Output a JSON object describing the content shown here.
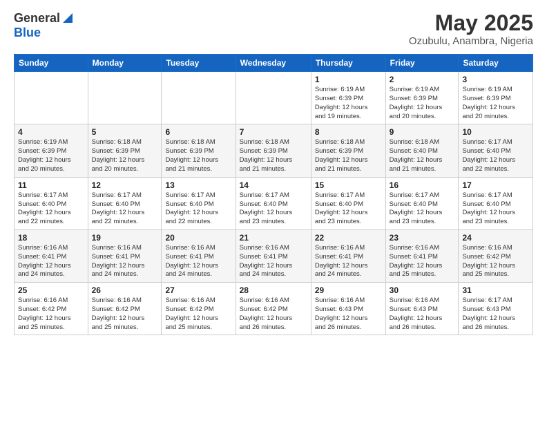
{
  "header": {
    "logo_general": "General",
    "logo_blue": "Blue",
    "title": "May 2025",
    "subtitle": "Ozubulu, Anambra, Nigeria"
  },
  "calendar": {
    "days_of_week": [
      "Sunday",
      "Monday",
      "Tuesday",
      "Wednesday",
      "Thursday",
      "Friday",
      "Saturday"
    ],
    "weeks": [
      [
        {
          "day": "",
          "info": ""
        },
        {
          "day": "",
          "info": ""
        },
        {
          "day": "",
          "info": ""
        },
        {
          "day": "",
          "info": ""
        },
        {
          "day": "1",
          "info": "Sunrise: 6:19 AM\nSunset: 6:39 PM\nDaylight: 12 hours\nand 19 minutes."
        },
        {
          "day": "2",
          "info": "Sunrise: 6:19 AM\nSunset: 6:39 PM\nDaylight: 12 hours\nand 20 minutes."
        },
        {
          "day": "3",
          "info": "Sunrise: 6:19 AM\nSunset: 6:39 PM\nDaylight: 12 hours\nand 20 minutes."
        }
      ],
      [
        {
          "day": "4",
          "info": "Sunrise: 6:19 AM\nSunset: 6:39 PM\nDaylight: 12 hours\nand 20 minutes."
        },
        {
          "day": "5",
          "info": "Sunrise: 6:18 AM\nSunset: 6:39 PM\nDaylight: 12 hours\nand 20 minutes."
        },
        {
          "day": "6",
          "info": "Sunrise: 6:18 AM\nSunset: 6:39 PM\nDaylight: 12 hours\nand 21 minutes."
        },
        {
          "day": "7",
          "info": "Sunrise: 6:18 AM\nSunset: 6:39 PM\nDaylight: 12 hours\nand 21 minutes."
        },
        {
          "day": "8",
          "info": "Sunrise: 6:18 AM\nSunset: 6:39 PM\nDaylight: 12 hours\nand 21 minutes."
        },
        {
          "day": "9",
          "info": "Sunrise: 6:18 AM\nSunset: 6:40 PM\nDaylight: 12 hours\nand 21 minutes."
        },
        {
          "day": "10",
          "info": "Sunrise: 6:17 AM\nSunset: 6:40 PM\nDaylight: 12 hours\nand 22 minutes."
        }
      ],
      [
        {
          "day": "11",
          "info": "Sunrise: 6:17 AM\nSunset: 6:40 PM\nDaylight: 12 hours\nand 22 minutes."
        },
        {
          "day": "12",
          "info": "Sunrise: 6:17 AM\nSunset: 6:40 PM\nDaylight: 12 hours\nand 22 minutes."
        },
        {
          "day": "13",
          "info": "Sunrise: 6:17 AM\nSunset: 6:40 PM\nDaylight: 12 hours\nand 22 minutes."
        },
        {
          "day": "14",
          "info": "Sunrise: 6:17 AM\nSunset: 6:40 PM\nDaylight: 12 hours\nand 23 minutes."
        },
        {
          "day": "15",
          "info": "Sunrise: 6:17 AM\nSunset: 6:40 PM\nDaylight: 12 hours\nand 23 minutes."
        },
        {
          "day": "16",
          "info": "Sunrise: 6:17 AM\nSunset: 6:40 PM\nDaylight: 12 hours\nand 23 minutes."
        },
        {
          "day": "17",
          "info": "Sunrise: 6:17 AM\nSunset: 6:40 PM\nDaylight: 12 hours\nand 23 minutes."
        }
      ],
      [
        {
          "day": "18",
          "info": "Sunrise: 6:16 AM\nSunset: 6:41 PM\nDaylight: 12 hours\nand 24 minutes."
        },
        {
          "day": "19",
          "info": "Sunrise: 6:16 AM\nSunset: 6:41 PM\nDaylight: 12 hours\nand 24 minutes."
        },
        {
          "day": "20",
          "info": "Sunrise: 6:16 AM\nSunset: 6:41 PM\nDaylight: 12 hours\nand 24 minutes."
        },
        {
          "day": "21",
          "info": "Sunrise: 6:16 AM\nSunset: 6:41 PM\nDaylight: 12 hours\nand 24 minutes."
        },
        {
          "day": "22",
          "info": "Sunrise: 6:16 AM\nSunset: 6:41 PM\nDaylight: 12 hours\nand 24 minutes."
        },
        {
          "day": "23",
          "info": "Sunrise: 6:16 AM\nSunset: 6:41 PM\nDaylight: 12 hours\nand 25 minutes."
        },
        {
          "day": "24",
          "info": "Sunrise: 6:16 AM\nSunset: 6:42 PM\nDaylight: 12 hours\nand 25 minutes."
        }
      ],
      [
        {
          "day": "25",
          "info": "Sunrise: 6:16 AM\nSunset: 6:42 PM\nDaylight: 12 hours\nand 25 minutes."
        },
        {
          "day": "26",
          "info": "Sunrise: 6:16 AM\nSunset: 6:42 PM\nDaylight: 12 hours\nand 25 minutes."
        },
        {
          "day": "27",
          "info": "Sunrise: 6:16 AM\nSunset: 6:42 PM\nDaylight: 12 hours\nand 25 minutes."
        },
        {
          "day": "28",
          "info": "Sunrise: 6:16 AM\nSunset: 6:42 PM\nDaylight: 12 hours\nand 26 minutes."
        },
        {
          "day": "29",
          "info": "Sunrise: 6:16 AM\nSunset: 6:43 PM\nDaylight: 12 hours\nand 26 minutes."
        },
        {
          "day": "30",
          "info": "Sunrise: 6:16 AM\nSunset: 6:43 PM\nDaylight: 12 hours\nand 26 minutes."
        },
        {
          "day": "31",
          "info": "Sunrise: 6:17 AM\nSunset: 6:43 PM\nDaylight: 12 hours\nand 26 minutes."
        }
      ]
    ]
  }
}
